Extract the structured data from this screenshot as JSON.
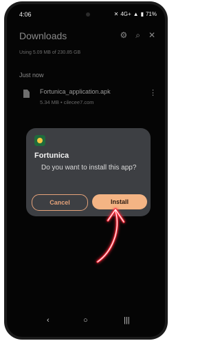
{
  "status_bar": {
    "time": "4:06",
    "battery": "71%",
    "network": "4G+"
  },
  "header": {
    "title": "Downloads"
  },
  "icons": {
    "settings": "gear-icon",
    "search": "search-icon",
    "close": "close-icon"
  },
  "usage_text": "Using 5.09 MB of 230.85 GB",
  "section_label": "Just now",
  "file": {
    "name": "Fortunica_application.apk",
    "meta": "5.34 MB • cilecee7.com"
  },
  "dialog": {
    "app_name": "Fortunica",
    "question": "Do you want to install this app?",
    "cancel_label": "Cancel",
    "install_label": "Install"
  },
  "colors": {
    "accent": "#f4b484",
    "arrow": "#ff2a3a",
    "dialog_bg": "#3d3f43"
  }
}
